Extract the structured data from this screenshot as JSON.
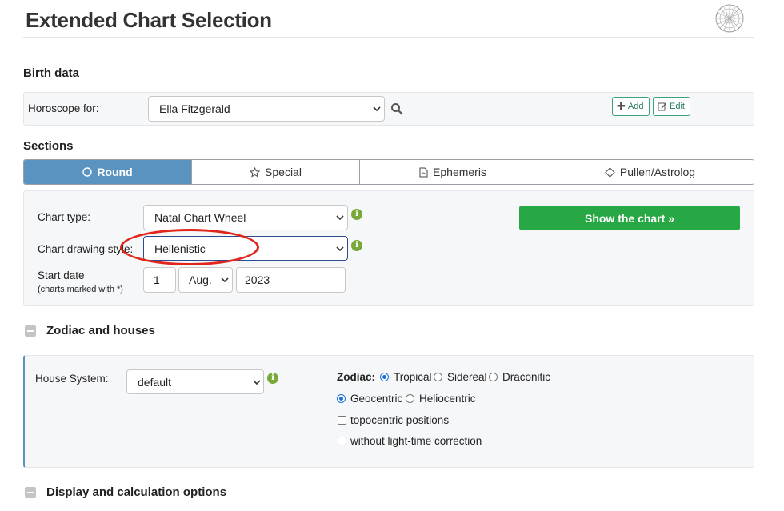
{
  "page": {
    "title": "Extended Chart Selection"
  },
  "birth_data": {
    "heading": "Birth data",
    "horoscope_label": "Horoscope for:",
    "horoscope_value": "Ella Fitzgerald",
    "add_label": "Add",
    "edit_label": "Edit"
  },
  "sections": {
    "heading": "Sections",
    "tabs": [
      {
        "label": "Round",
        "icon": "circle-icon",
        "active": true
      },
      {
        "label": "Special",
        "icon": "star-icon",
        "active": false
      },
      {
        "label": "Ephemeris",
        "icon": "pdf-file-icon",
        "active": false
      },
      {
        "label": "Pullen/Astrolog",
        "icon": "diamond-icon",
        "active": false
      }
    ]
  },
  "chart_options": {
    "chart_type_label": "Chart type:",
    "chart_type_value": "Natal Chart Wheel",
    "drawing_style_label": "Chart drawing style:",
    "drawing_style_value": "Hellenistic",
    "start_date_label": "Start date",
    "start_date_note": "(charts marked with *)",
    "day": "1",
    "month": "Aug.",
    "year": "2023",
    "show_button": "Show the chart »"
  },
  "zodiac_houses": {
    "heading": "Zodiac and houses",
    "house_system_label": "House System:",
    "house_system_value": "default",
    "zodiac_label": "Zodiac:",
    "zodiac_options": [
      {
        "label": "Tropical",
        "selected": true
      },
      {
        "label": "Sidereal",
        "selected": false
      },
      {
        "label": "Draconitic",
        "selected": false
      }
    ],
    "centric_options": [
      {
        "label": "Geocentric",
        "selected": true
      },
      {
        "label": "Heliocentric",
        "selected": false
      }
    ],
    "checkboxes": [
      {
        "label": "topocentric positions",
        "checked": false
      },
      {
        "label": "without light-time correction",
        "checked": false
      }
    ]
  },
  "display_options": {
    "heading": "Display and calculation options"
  },
  "colors": {
    "tab_active": "#5b93c0",
    "primary_button": "#28a745",
    "info_icon": "#78a83a",
    "highlight_ring": "#e0261b",
    "radio_selected": "#1a6fd8"
  }
}
